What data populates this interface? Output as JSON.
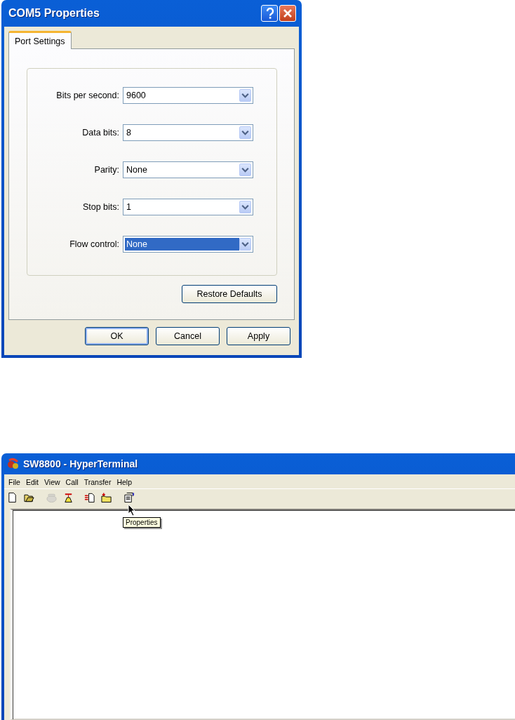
{
  "dialog": {
    "title": "COM5 Properties",
    "tabs": [
      {
        "label": "Port Settings",
        "selected": true
      }
    ],
    "fields": [
      {
        "label": "Bits per second:",
        "value": "9600",
        "highlighted": false
      },
      {
        "label": "Data bits:",
        "value": "8",
        "highlighted": false
      },
      {
        "label": "Parity:",
        "value": "None",
        "highlighted": false
      },
      {
        "label": "Stop bits:",
        "value": "1",
        "highlighted": false
      },
      {
        "label": "Flow control:",
        "value": "None",
        "highlighted": true
      }
    ],
    "restore_button": "Restore Defaults",
    "buttons": [
      {
        "label": "OK",
        "default": true
      },
      {
        "label": "Cancel",
        "default": false
      },
      {
        "label": "Apply",
        "default": false
      }
    ]
  },
  "terminal_window": {
    "title": "SW8800 - HyperTerminal",
    "menu": [
      "File",
      "Edit",
      "View",
      "Call",
      "Transfer",
      "Help"
    ],
    "toolbar": [
      {
        "kind": "new",
        "disabled": false
      },
      {
        "kind": "open",
        "disabled": false
      },
      {
        "kind": "phone",
        "disabled": true
      },
      {
        "kind": "dial",
        "disabled": false
      },
      {
        "kind": "send",
        "disabled": false
      },
      {
        "kind": "receive",
        "disabled": false
      },
      {
        "kind": "properties",
        "disabled": false
      }
    ],
    "tooltip": "Properties"
  }
}
